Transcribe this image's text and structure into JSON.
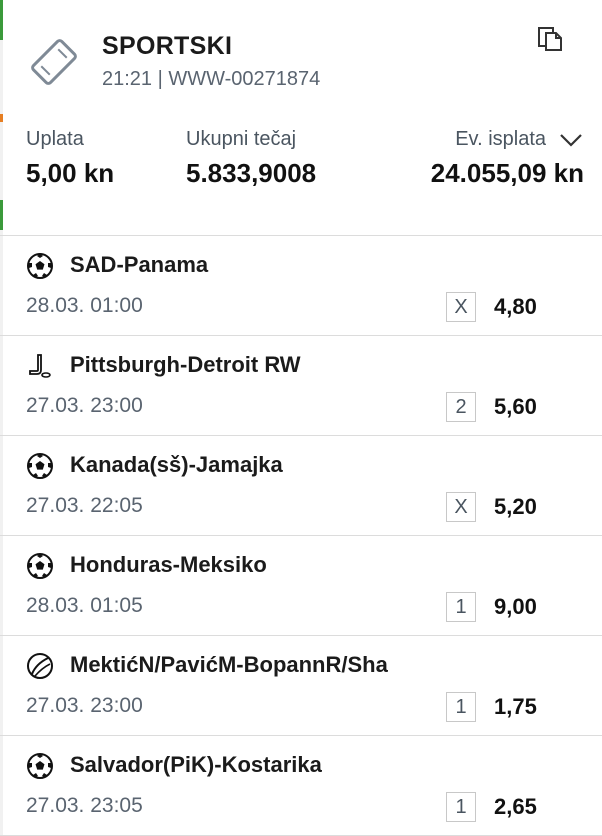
{
  "ticket": {
    "title": "SPORTSKI",
    "subtitle": "21:21 | WWW-00271874"
  },
  "summary": {
    "payment_label": "Uplata",
    "payment_value": "5,00 kn",
    "total_odds_label": "Ukupni tečaj",
    "total_odds_value": "5.833,9008",
    "payout_label": "Ev. isplata",
    "payout_value": "24.055,09 kn"
  },
  "bets": [
    {
      "sport_icon": "soccer-ball-icon",
      "match": "SAD-Panama",
      "date": "28.03. 01:00",
      "pick": "X",
      "odd": "4,80"
    },
    {
      "sport_icon": "hockey-stick-icon",
      "match": "Pittsburgh-Detroit RW",
      "date": "27.03. 23:00",
      "pick": "2",
      "odd": "5,60"
    },
    {
      "sport_icon": "soccer-ball-icon",
      "match": "Kanada(sš)-Jamajka",
      "date": "27.03. 22:05",
      "pick": "X",
      "odd": "5,20"
    },
    {
      "sport_icon": "soccer-ball-icon",
      "match": "Honduras-Meksiko",
      "date": "28.03. 01:05",
      "pick": "1",
      "odd": "9,00"
    },
    {
      "sport_icon": "tennis-ball-icon",
      "match": "MektićN/PavićM-BopannR/Sha",
      "date": "27.03. 23:00",
      "pick": "1",
      "odd": "1,75"
    },
    {
      "sport_icon": "soccer-ball-icon",
      "match": "Salvador(PiK)-Kostarika",
      "date": "27.03. 23:05",
      "pick": "1",
      "odd": "2,65"
    }
  ],
  "colors": {
    "text_primary": "#1b1b1b",
    "text_secondary": "#5a6470",
    "divider": "#dcdcdc",
    "edge_green": "#3b9a3b",
    "edge_orange": "#e67e22"
  }
}
